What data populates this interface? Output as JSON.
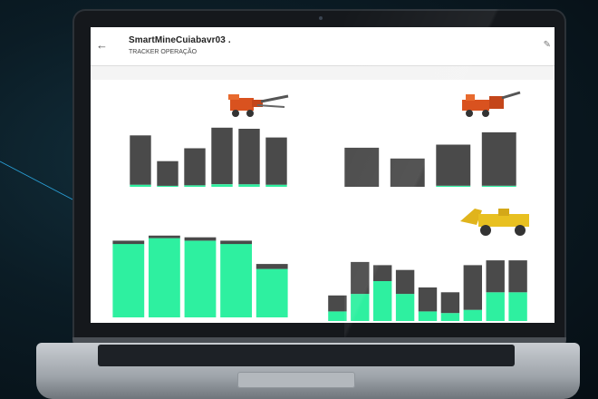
{
  "app": {
    "title": "SmartMineCuiabavr03 .",
    "subtitle": "TRACKER OPERAÇÃO",
    "back_icon": "arrow-left-icon",
    "edit_icon": "pencil-icon"
  },
  "colors": {
    "green": "#2ef0a0",
    "dark": "#4a4a4a",
    "axis_text": "#666666"
  },
  "panels": [
    {
      "id": "top-left",
      "title": "",
      "legend": [
        "",
        ""
      ],
      "machine_icon": "jumbo-drill-rig-icon",
      "chart_data": {
        "type": "bar",
        "categories": [
          "",
          "",
          "",
          "",
          "",
          ""
        ],
        "series": [
          {
            "values": [
              4,
              2,
              3,
              5,
              5,
              4
            ]
          },
          {
            "values": [
              96,
              48,
              72,
              110,
              108,
              92
            ]
          }
        ],
        "ylim": [
          0,
          120
        ]
      }
    },
    {
      "id": "top-right",
      "title": "",
      "legend": [
        "",
        ""
      ],
      "machine_icon": "bolter-rig-icon",
      "chart_data": {
        "type": "bar",
        "categories": [
          "",
          "",
          "",
          ""
        ],
        "series": [
          {
            "values": [
              0,
              0,
              2,
              2
            ]
          },
          {
            "values": [
              76,
              55,
              80,
              104
            ]
          }
        ],
        "ylim": [
          0,
          120
        ]
      }
    },
    {
      "id": "bottom-left",
      "title": "",
      "legend": [
        "",
        ""
      ],
      "machine_icon": "",
      "chart_data": {
        "type": "bar",
        "categories": [
          "",
          "",
          "",
          "",
          ""
        ],
        "series": [
          {
            "values": [
              88,
              95,
              92,
              88,
              58
            ]
          },
          {
            "values": [
              4,
              3,
              4,
              4,
              6
            ]
          }
        ],
        "ylim": [
          0,
          100
        ]
      }
    },
    {
      "id": "bottom-right",
      "title": "",
      "legend": [
        "",
        ""
      ],
      "machine_icon": "underground-loader-icon",
      "chart_data": {
        "type": "bar",
        "categories": [
          "",
          "",
          "",
          "",
          "",
          "",
          "",
          "",
          ""
        ],
        "series": [
          {
            "values": [
              12,
              34,
              50,
              34,
              12,
              10,
              14,
              36,
              36
            ]
          },
          {
            "values": [
              20,
              40,
              20,
              30,
              30,
              26,
              56,
              40,
              40
            ]
          }
        ],
        "ylim": [
          0,
          100
        ]
      }
    }
  ]
}
